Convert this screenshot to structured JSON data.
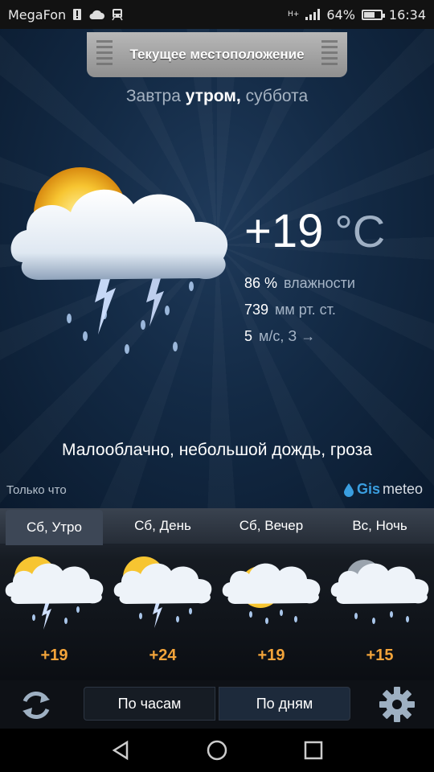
{
  "status_bar": {
    "carrier": "MegaFon",
    "network": "H+",
    "battery": "64%",
    "battery_level": 0.64,
    "time": "16:34",
    "icons": [
      "sim-alert-icon",
      "cloud-icon",
      "train-icon",
      "signal-icon",
      "battery-icon"
    ]
  },
  "location_tab": {
    "label": "Текущее местоположение"
  },
  "period_title": {
    "prefix": "Завтра",
    "bold": "утром,",
    "suffix": "суббота"
  },
  "current": {
    "temperature": "+19",
    "unit": "°C",
    "humidity_value": "86 %",
    "humidity_label": "влажности",
    "pressure_value": "739",
    "pressure_label": "мм рт. ст.",
    "wind_value": "5",
    "wind_label": "м/с, З →",
    "condition": "Малооблачно,  небольшой дождь,  гроза",
    "updated": "Только что",
    "icon": "sun-cloud-thunderstorm-icon"
  },
  "brand": {
    "part1": "Gis",
    "part2": "meteo"
  },
  "forecast": [
    {
      "label": "Сб, Утро",
      "temp": "+19",
      "icon": "sun-cloud-thunderstorm-icon",
      "active": true
    },
    {
      "label": "Сб, День",
      "temp": "+24",
      "icon": "sun-cloud-thunderstorm-icon",
      "active": false
    },
    {
      "label": "Сб, Вечер",
      "temp": "+19",
      "icon": "sun-cloud-rain-icon",
      "active": false
    },
    {
      "label": "Вс, Ночь",
      "temp": "+15",
      "icon": "moon-cloud-rain-icon",
      "active": false
    }
  ],
  "toolbar": {
    "hours": "По часам",
    "days": "По дням",
    "selected": "days"
  },
  "colors": {
    "accent_temp": "#f3a43a",
    "brand_blue": "#3a9ee0",
    "background": "#132a45"
  }
}
